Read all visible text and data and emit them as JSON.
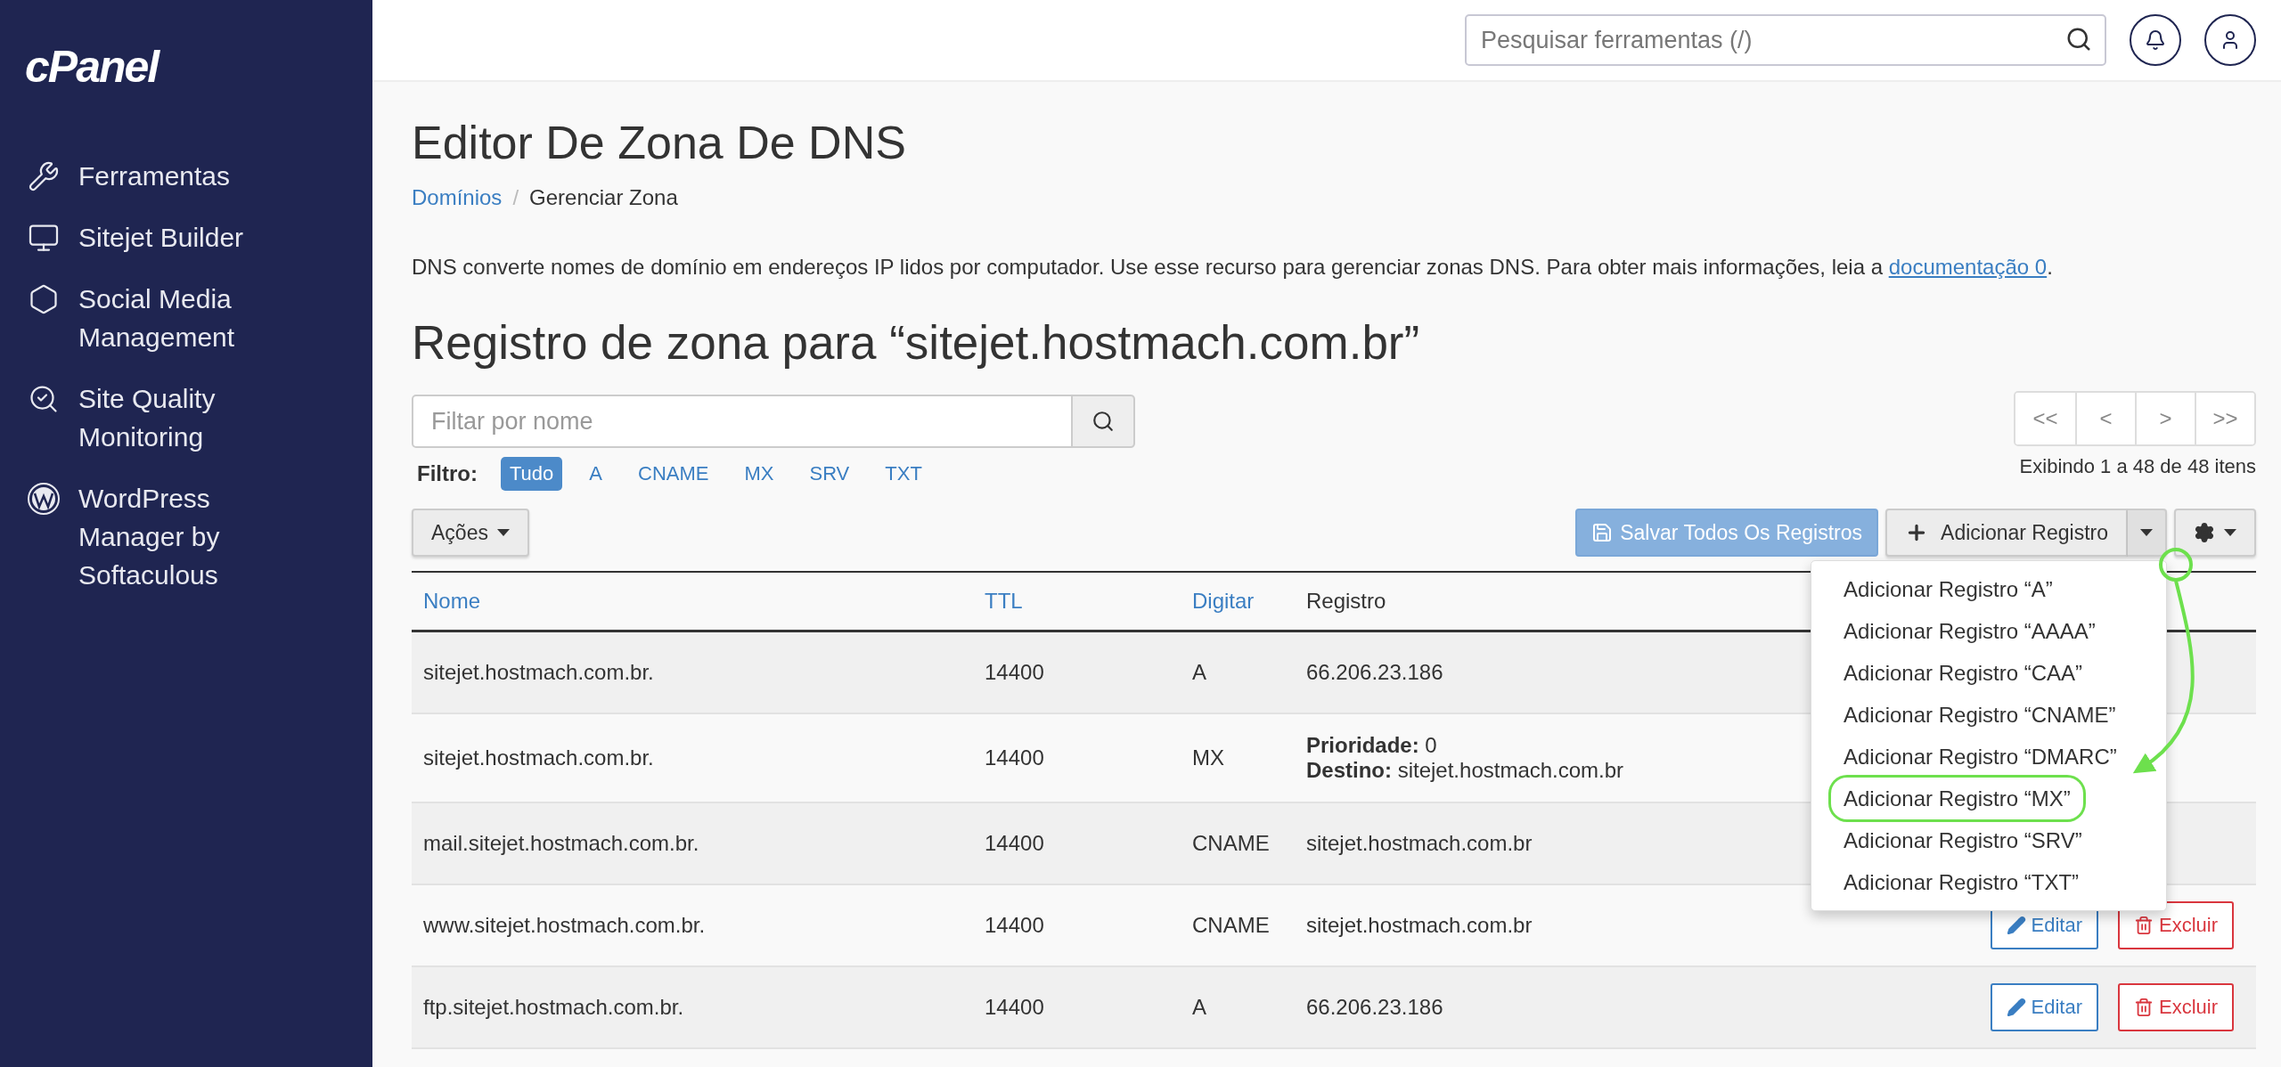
{
  "sidebar": {
    "logo": "cPanel",
    "items": [
      {
        "label": "Ferramentas"
      },
      {
        "label": "Sitejet Builder"
      },
      {
        "label": "Social Media Management"
      },
      {
        "label": "Site Quality Monitoring"
      },
      {
        "label": "WordPress Manager by Softaculous"
      }
    ]
  },
  "header": {
    "search": {
      "placeholder": "Pesquisar ferramentas (/)"
    }
  },
  "page": {
    "title": "Editor De Zona De DNS",
    "breadcrumb_separator": "/",
    "breadcrumb": [
      {
        "label": "Domínios",
        "link": true
      },
      {
        "label": "Gerenciar Zona",
        "link": false
      }
    ],
    "description": {
      "text": "DNS converte nomes de domínio em endereços IP lidos por computador. Use esse recurso para gerenciar zonas DNS. Para obter mais informações, leia a",
      "link": "documentação 0",
      "after": "."
    },
    "zone_heading": "Registro de zona para “sitejet.hostmach.com.br”"
  },
  "filter": {
    "placeholder": "Filtar por nome",
    "label": "Filtro:",
    "options": [
      {
        "label": "Tudo",
        "selected": true
      },
      {
        "label": "A",
        "selected": false
      },
      {
        "label": "CNAME",
        "selected": false
      },
      {
        "label": "MX",
        "selected": false
      },
      {
        "label": "SRV",
        "selected": false
      },
      {
        "label": "TXT",
        "selected": false
      }
    ]
  },
  "pagination": {
    "buttons": [
      "<<",
      "<",
      ">",
      ">>"
    ],
    "summary": "Exibindo 1 a 48 de 48 itens"
  },
  "toolbar": {
    "actions": "Ações",
    "save": "Salvar Todos Os Registros",
    "add": "Adicionar Registro"
  },
  "add_menu": {
    "open": true,
    "items": [
      {
        "label": "Adicionar Registro “A”",
        "highlighted": false
      },
      {
        "label": "Adicionar Registro “AAAA”",
        "highlighted": false
      },
      {
        "label": "Adicionar Registro “CAA”",
        "highlighted": false
      },
      {
        "label": "Adicionar Registro “CNAME”",
        "highlighted": false
      },
      {
        "label": "Adicionar Registro “DMARC”",
        "highlighted": false
      },
      {
        "label": "Adicionar Registro “MX”",
        "highlighted": true
      },
      {
        "label": "Adicionar Registro “SRV”",
        "highlighted": false
      },
      {
        "label": "Adicionar Registro “TXT”",
        "highlighted": false
      }
    ]
  },
  "table": {
    "columns": [
      {
        "label": "Nome",
        "sortable": true
      },
      {
        "label": "TTL",
        "sortable": true
      },
      {
        "label": "Digitar",
        "sortable": true
      },
      {
        "label": "Registro",
        "sortable": false
      }
    ],
    "rows": [
      {
        "name": "sitejet.hostmach.com.br.",
        "ttl": "14400",
        "type": "A",
        "record": [
          "66.206.23.186"
        ],
        "actions": []
      },
      {
        "name": "sitejet.hostmach.com.br.",
        "ttl": "14400",
        "type": "MX",
        "record": [
          "**Prioridade:** 0",
          "**Destino:** sitejet.hostmach.com.br"
        ],
        "actions": []
      },
      {
        "name": "mail.sitejet.hostmach.com.br.",
        "ttl": "14400",
        "type": "CNAME",
        "record": [
          "sitejet.hostmach.com.br"
        ],
        "actions": []
      },
      {
        "name": "www.sitejet.hostmach.com.br.",
        "ttl": "14400",
        "type": "CNAME",
        "record": [
          "sitejet.hostmach.com.br"
        ],
        "actions": [
          {
            "kind": "edit",
            "label": "Editar"
          },
          {
            "kind": "delete",
            "label": "Excluir"
          }
        ]
      },
      {
        "name": "ftp.sitejet.hostmach.com.br.",
        "ttl": "14400",
        "type": "A",
        "record": [
          "66.206.23.186"
        ],
        "actions": [
          {
            "kind": "edit",
            "label": "Editar"
          },
          {
            "kind": "delete",
            "label": "Excluir"
          }
        ]
      }
    ]
  }
}
